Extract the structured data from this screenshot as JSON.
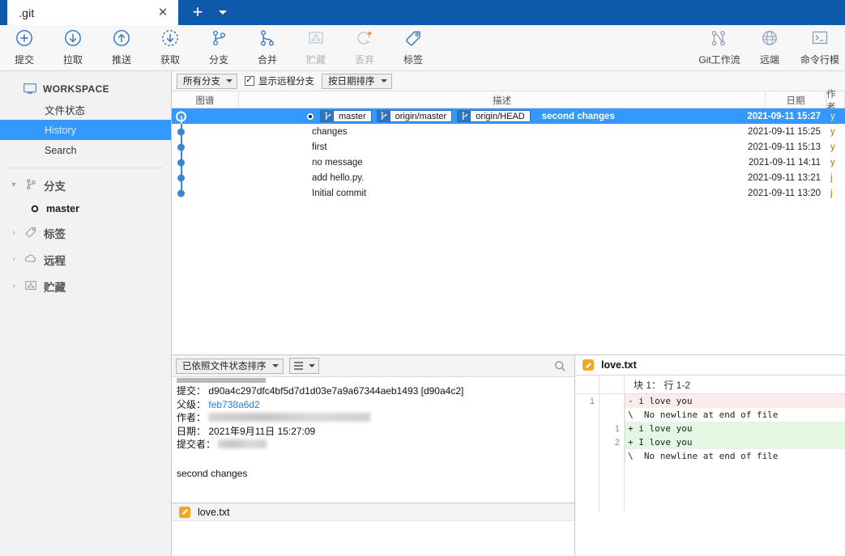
{
  "titlebar": {
    "tab_label": ".git",
    "close_icon": "close-icon",
    "new_tab_icon": "plus-icon",
    "tab_menu_icon": "chevron-down-icon",
    "bg_color": "#0f59ab"
  },
  "toolbar": {
    "items": [
      {
        "label": "提交",
        "icon": "commit-plus-circle-icon",
        "disabled": false
      },
      {
        "label": "拉取",
        "icon": "pull-down-arrow-circle-icon",
        "disabled": false
      },
      {
        "label": "推送",
        "icon": "push-up-arrow-circle-icon",
        "disabled": false
      },
      {
        "label": "获取",
        "icon": "fetch-dashed-circle-icon",
        "disabled": false
      },
      {
        "label": "分支",
        "icon": "branch-icon",
        "disabled": false
      },
      {
        "label": "合并",
        "icon": "merge-icon",
        "disabled": false
      },
      {
        "label": "贮藏",
        "icon": "stash-box-icon",
        "disabled": true
      },
      {
        "label": "丢弃",
        "icon": "discard-revert-icon",
        "disabled": true
      },
      {
        "label": "标签",
        "icon": "tag-icon",
        "disabled": false
      }
    ],
    "right_items": [
      {
        "label": "Git工作流",
        "icon": "gitflow-icon",
        "disabled": false
      },
      {
        "label": "远端",
        "icon": "globe-remote-icon",
        "disabled": false
      },
      {
        "label": "命令行模",
        "icon": "terminal-icon",
        "disabled": false
      }
    ]
  },
  "sidebar": {
    "workspace": {
      "label": "WORKSPACE",
      "icon": "monitor-icon"
    },
    "items": [
      {
        "label": "文件状态",
        "active": false
      },
      {
        "label": "History",
        "active": true
      },
      {
        "label": "Search",
        "active": false
      }
    ],
    "groups": [
      {
        "label": "分支",
        "icon": "branch-icon",
        "expanded": true,
        "tri": "▾"
      },
      {
        "label": "标签",
        "icon": "tag-icon",
        "expanded": false,
        "tri": "›"
      },
      {
        "label": "远程",
        "icon": "cloud-icon",
        "expanded": false,
        "tri": "›"
      },
      {
        "label": "贮藏",
        "icon": "stash-box-icon",
        "expanded": false,
        "tri": "›"
      }
    ],
    "branches": [
      {
        "label": "master",
        "icon": "branch-dot-icon"
      }
    ]
  },
  "history": {
    "filter_branches": "所有分支",
    "show_remote_branches": "显示远程分支",
    "show_remote_checked": true,
    "sort_order": "按日期排序",
    "columns": [
      "图谱",
      "描述",
      "日期",
      "作者"
    ],
    "rows": [
      {
        "message": "second changes",
        "date": "2021-09-11 15:27",
        "author": "y",
        "selected": true,
        "refs": [
          {
            "name": "master",
            "icon": "branch-icon"
          },
          {
            "name": "origin/master",
            "icon": "branch-icon"
          },
          {
            "name": "origin/HEAD",
            "icon": "branch-icon"
          }
        ]
      },
      {
        "message": "changes",
        "date": "2021-09-11 15:25",
        "author": "y",
        "selected": false,
        "refs": []
      },
      {
        "message": "first",
        "date": "2021-09-11 15:13",
        "author": "y",
        "selected": false,
        "refs": []
      },
      {
        "message": "no message",
        "date": "2021-09-11 14:11",
        "author": "y",
        "selected": false,
        "refs": []
      },
      {
        "message": "add hello.py.",
        "date": "2021-09-11 13:21",
        "author": "j",
        "selected": false,
        "refs": []
      },
      {
        "message": "Initial commit",
        "date": "2021-09-11 13:20",
        "author": "j",
        "selected": false,
        "refs": []
      }
    ]
  },
  "detail": {
    "sort_label": "已依照文件状态排序",
    "view_icon": "list-view-icon",
    "search_icon": "search-icon",
    "fields": [
      {
        "key": "提交：",
        "value": "d90a4c297dfc4bf5d7d1d03e7a9a67344aeb1493 [d90a4c2]",
        "style": "hash"
      },
      {
        "key": "父级：",
        "value": "feb738a6d2",
        "style": "link"
      },
      {
        "key": "作者：",
        "value": "",
        "style": "redacted",
        "redacted_width": 200
      },
      {
        "key": "日期：",
        "value": "2021年9月11日 15:27:09",
        "style": "plain"
      },
      {
        "key": "提交者：",
        "value": "",
        "style": "redacted",
        "redacted_width": 60
      }
    ],
    "message": "second changes"
  },
  "filelist": {
    "files": [
      {
        "name": "love.txt",
        "icon": "edit-pencil-icon"
      }
    ]
  },
  "diff": {
    "filename": "love.txt",
    "file_icon": "edit-pencil-icon",
    "hunk_header": "块 1：  行 1-2",
    "lines": [
      {
        "old": "1",
        "new": "",
        "type": "del",
        "text": "- i love you"
      },
      {
        "old": "",
        "new": "",
        "type": "ctx",
        "text": "\\  No newline at end of file"
      },
      {
        "old": "",
        "new": "1",
        "type": "add",
        "text": "+ i love you"
      },
      {
        "old": "",
        "new": "2",
        "type": "add",
        "text": "+ I love you"
      },
      {
        "old": "",
        "new": "",
        "type": "ctx",
        "text": "\\  No newline at end of file"
      }
    ]
  },
  "colors": {
    "titlebar": "#0f59ab",
    "selection": "#3399ff",
    "accent_blue": "#2f74c0",
    "file_icon": "#f5a623",
    "add_bg": "#e3f7e3",
    "del_bg": "#fdeaea"
  }
}
